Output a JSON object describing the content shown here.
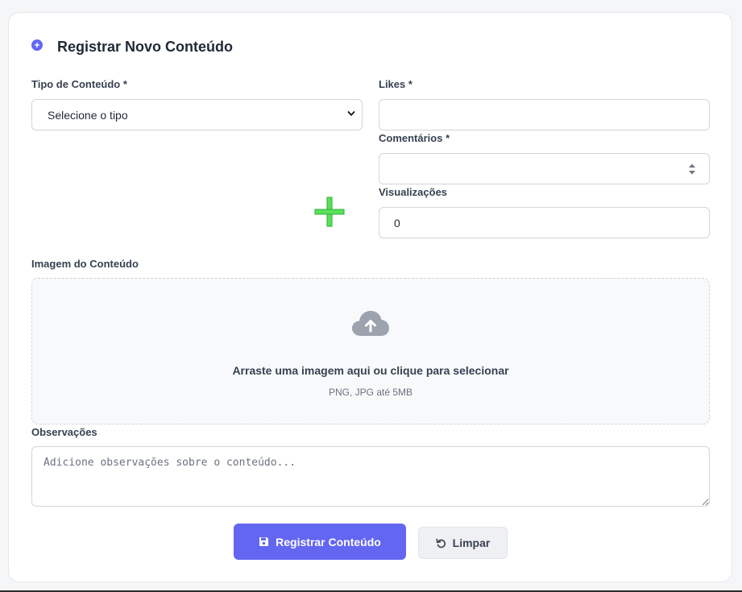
{
  "header": {
    "title": "Registrar Novo Conteúdo",
    "icon": "plus-circle-icon"
  },
  "form": {
    "content_type": {
      "label": "Tipo de Conteúdo *",
      "selected": "Selecione o tipo"
    },
    "likes": {
      "label": "Likes *",
      "value": ""
    },
    "comments": {
      "label": "Comentários *",
      "value": ""
    },
    "views": {
      "label": "Visualizações",
      "value": "0"
    },
    "image": {
      "label": "Imagem do Conteúdo",
      "drop_text": "Arraste uma imagem aqui ou clique para selecionar",
      "hint": "PNG, JPG até 5MB",
      "icon": "cloud-upload-icon"
    },
    "notes": {
      "label": "Observações",
      "placeholder": "Adicione observações sobre o conteúdo..."
    }
  },
  "actions": {
    "submit_label": "Registrar Conteúdo",
    "reset_label": "Limpar"
  },
  "colors": {
    "accent": "#6366f1",
    "plus_marker": "#4ade4a"
  }
}
